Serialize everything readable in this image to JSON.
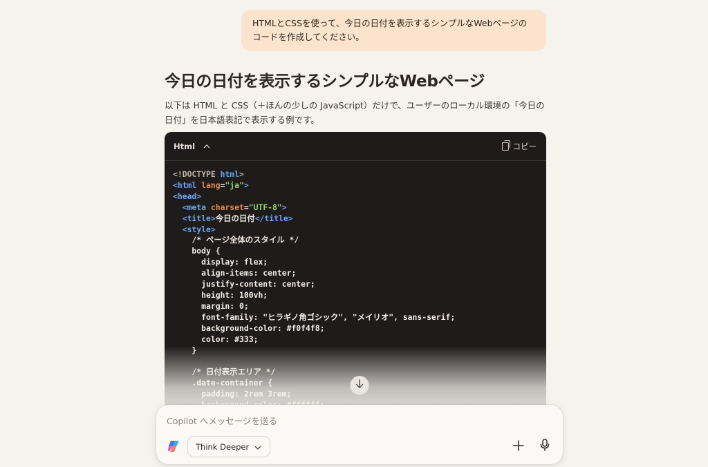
{
  "user_message": "HTMLとCSSを使って、今日の日付を表示するシンプルなWebページのコードを作成してください。",
  "response": {
    "heading": "今日の日付を表示するシンプルなWebページ",
    "intro": "以下は HTML と CSS（＋ほんの少しの JavaScript）だけで、ユーザーのローカル環境の「今日の日付」を日本語表記で表示する例です。"
  },
  "code_block": {
    "language": "Html",
    "copy_label": "コピー"
  },
  "composer": {
    "placeholder": "Copilot へメッセージを送る",
    "think_deeper_label": "Think Deeper"
  },
  "icons": {
    "collapse": "chevron-up-icon",
    "copy": "copy-icon",
    "scroll": "arrow-down-icon",
    "logo": "copilot-logo-icon",
    "dropdown": "chevron-down-icon",
    "add": "plus-icon",
    "voice": "microphone-icon"
  }
}
